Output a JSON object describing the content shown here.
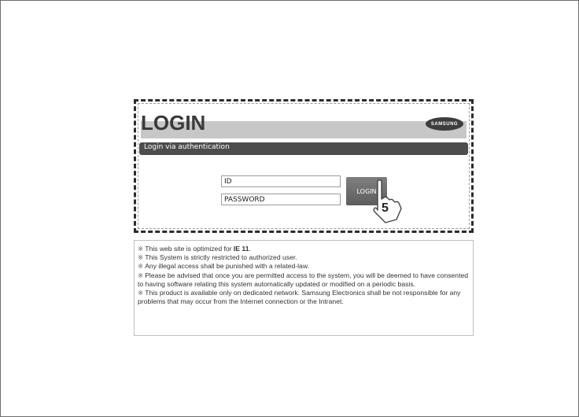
{
  "login": {
    "title": "LOGIN",
    "logo_text": "SAMSUNG",
    "auth_bar_label": "Login via authentication",
    "id_placeholder": "ID",
    "password_placeholder": "PASSWORD",
    "login_button_label": "LOGIN",
    "step_number": "5"
  },
  "notices": {
    "line1_prefix": "This web site is optimized for ",
    "line1_bold": "IE 11",
    "line1_suffix": ".",
    "line2": "This System is strictly restricted to authorized user.",
    "line3": "Any illegal access shall be punished with a related-law.",
    "line4": "Please be advised that once you are permitted access to the system, you will be deemed to have consented to having software relating this system automatically updated or modified on a periodic basis.",
    "line5": "This product is available only on dedicated network. Samsung Electronics shall be not responsible for any problems that may occur from the Internet connection or the Intranet.",
    "bullet_symbol": "※"
  }
}
